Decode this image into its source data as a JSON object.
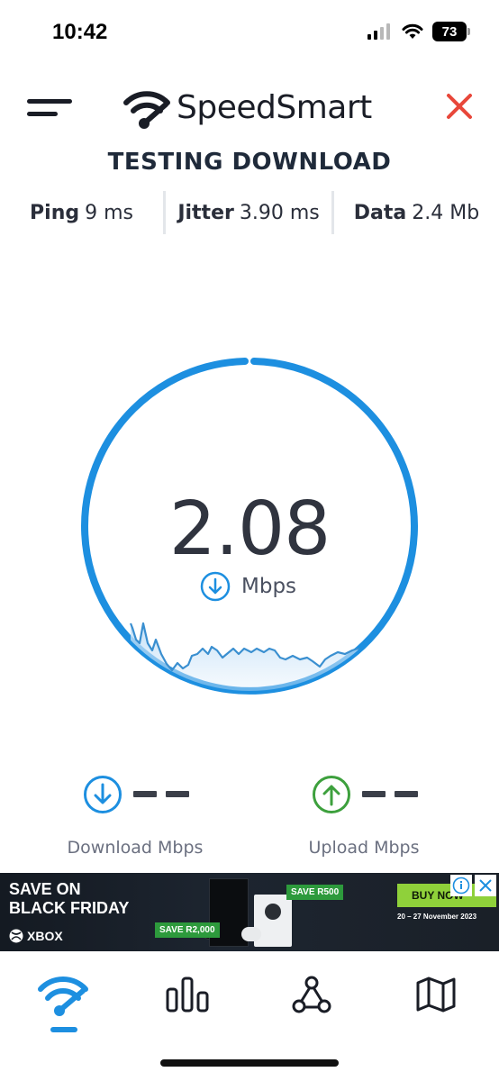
{
  "status_bar": {
    "time": "10:42",
    "battery": "73"
  },
  "header": {
    "app_name": "SpeedSmart"
  },
  "test": {
    "title": "TESTING DOWNLOAD",
    "ping_label": "Ping",
    "ping_value": "9 ms",
    "jitter_label": "Jitter",
    "jitter_value": "3.90 ms",
    "data_label": "Data",
    "data_value": "2.4 Mb"
  },
  "gauge": {
    "speed": "2.08",
    "unit": "Mbps",
    "accent": "#1d8fe0"
  },
  "results": {
    "download": {
      "value": "– –",
      "label": "Download Mbps",
      "color": "#1d8fe0"
    },
    "upload": {
      "value": "– –",
      "label": "Upload Mbps",
      "color": "#3da03d"
    }
  },
  "ad": {
    "headline_1": "SAVE ON",
    "headline_2": "BLACK FRIDAY",
    "brand": "XBOX",
    "tag_1": "SAVE R2,000",
    "tag_2": "SAVE R500",
    "cta": "BUY NOW",
    "dates": "20 – 27 November 2023"
  },
  "tabs": [
    {
      "name": "speed-test",
      "icon": "wifi-icon",
      "active": true
    },
    {
      "name": "results",
      "icon": "bar-chart-icon",
      "active": false
    },
    {
      "name": "network",
      "icon": "network-icon",
      "active": false
    },
    {
      "name": "map",
      "icon": "map-icon",
      "active": false
    }
  ]
}
